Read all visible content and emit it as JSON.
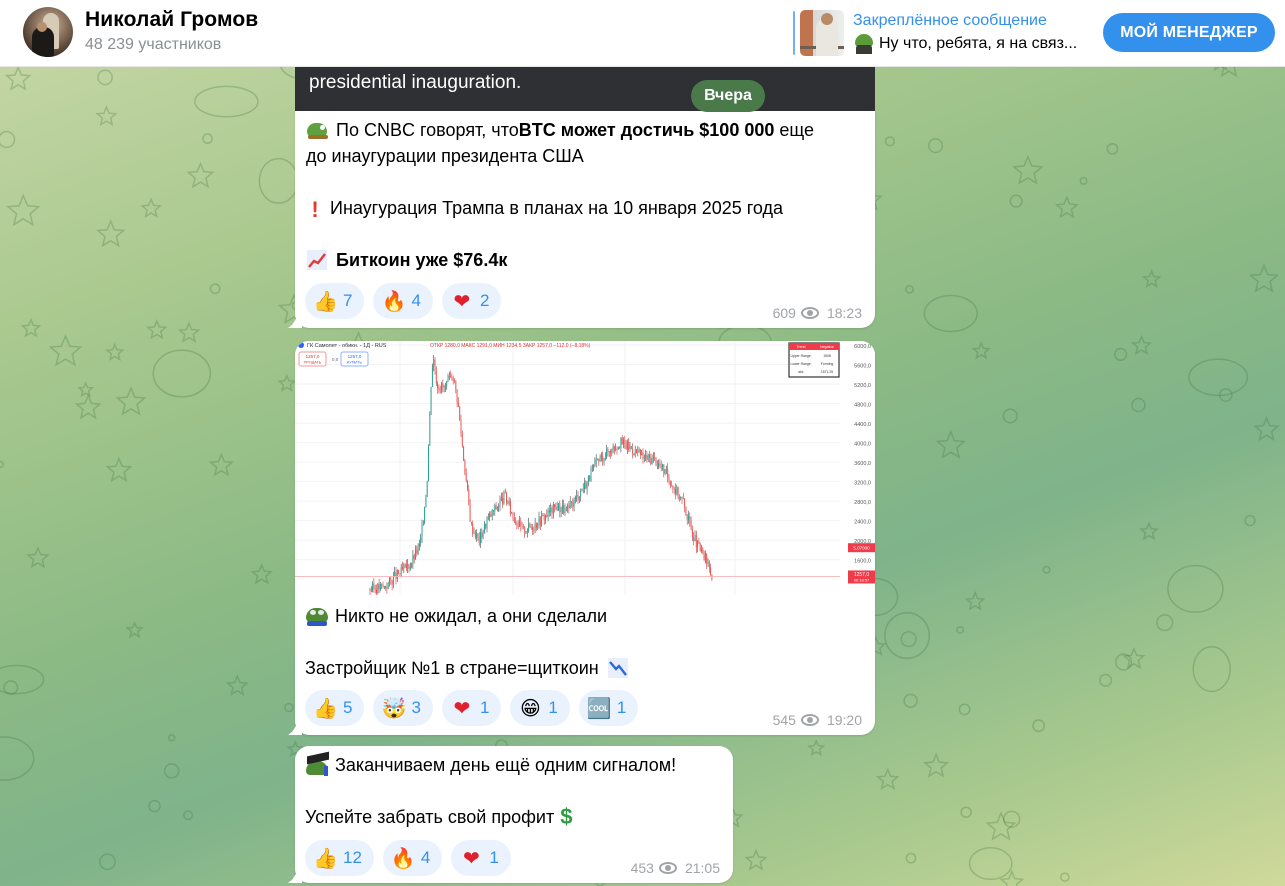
{
  "header": {
    "channel_name": "Николай Громов",
    "members": "48 239 участников",
    "pinned": {
      "title": "Закреплённое сообщение",
      "preview": "Ну что, ребята, я на связ..."
    },
    "manager_button": "МОЙ МЕНЕДЖЕР"
  },
  "date_separator": "Вчера",
  "link_preview_text": "presidential inauguration.",
  "messages": [
    {
      "lines": [
        {
          "icon": "pepe-sitting-icon",
          "parts": [
            {
              "text": "По CNBC говорят, что ",
              "bold": false
            },
            {
              "text": "BTC может достичь $100 000",
              "bold": true
            },
            {
              "text": " еще",
              "bold": false
            }
          ]
        },
        {
          "text": "до инаугурации президента США"
        },
        {
          "icon": "exclamation-icon",
          "text": "Инаугурация Трампа в планах на 10 января 2025 года"
        },
        {
          "icon": "chart-increasing-icon",
          "text": "Биткоин уже $76.4к",
          "bold": true
        }
      ],
      "reactions": [
        {
          "emoji": "👍",
          "icon": "thumbs-up-icon",
          "count": "7"
        },
        {
          "emoji": "🔥",
          "icon": "fire-icon",
          "count": "4"
        },
        {
          "emoji": "❤",
          "icon": "heart-icon",
          "count": "2"
        }
      ],
      "views": "609",
      "time": "18:23"
    },
    {
      "chart_image": {
        "ticker": "ГК Самолет - обикн. - 1Д - RUS",
        "ohlc": "ОТКР 1280,0 МАКС 1291,0 МИН 1234,5 ЗАКР 1257,0 −112,0 (−8,18%)",
        "sell_price": "1257,0",
        "sell_label": "ПРОДАТЬ",
        "spread": "0,0",
        "buy_price": "1257,0",
        "buy_label": "КУПИТЬ",
        "y_ticks": [
          "6000,0",
          "5600,0",
          "5200,0",
          "4800,0",
          "4400,0",
          "4000,0",
          "3600,0",
          "3200,0",
          "2800,0",
          "2400,0",
          "2000,0",
          "1600,0"
        ],
        "last_price": "1257,0",
        "last_price_timer": "06:18:57",
        "level_label": "5,07000",
        "info_table": {
          "header": [
            "Trend",
            "Negative"
          ],
          "rows": [
            [
              "Upper Range:",
              "1508"
            ],
            [
              "Lower Range:",
              "Forming"
            ],
            [
              "atd:",
              "1571.25"
            ]
          ]
        }
      },
      "lines": [
        {
          "icon": "pepe-face-icon",
          "text": "Никто не ожидал, а они сделали"
        },
        {
          "text": "Застройщик №1 в стране=щиткоин",
          "trailing_icon": "chart-decreasing-icon"
        }
      ],
      "reactions": [
        {
          "emoji": "👍",
          "icon": "thumbs-up-icon",
          "count": "5"
        },
        {
          "emoji": "🤯",
          "icon": "exploding-head-icon",
          "count": "3"
        },
        {
          "emoji": "❤",
          "icon": "heart-icon",
          "count": "1"
        },
        {
          "emoji": "😁",
          "icon": "grinning-face-icon",
          "count": "1"
        },
        {
          "emoji": "🆒",
          "icon": "cool-icon",
          "count": "1"
        }
      ],
      "views": "545",
      "time": "19:20"
    },
    {
      "lines": [
        {
          "icon": "pepe-hat-icon",
          "text": "Заканчиваем день ещё одним сигналом!"
        },
        {
          "text": "Успейте забрать свой профит",
          "trailing_icon": "dollar-icon"
        }
      ],
      "reactions": [
        {
          "emoji": "👍",
          "icon": "thumbs-up-icon",
          "count": "12"
        },
        {
          "emoji": "🔥",
          "icon": "fire-icon",
          "count": "4"
        },
        {
          "emoji": "❤",
          "icon": "heart-icon",
          "count": "1"
        }
      ],
      "views": "453",
      "time": "21:05"
    }
  ],
  "colors": {
    "accent": "#3390ec",
    "date_pill": "#4a7a4a",
    "reaction_bg": "#eaf3fd",
    "candle_up": "#26a69a",
    "candle_down": "#ef5350"
  }
}
